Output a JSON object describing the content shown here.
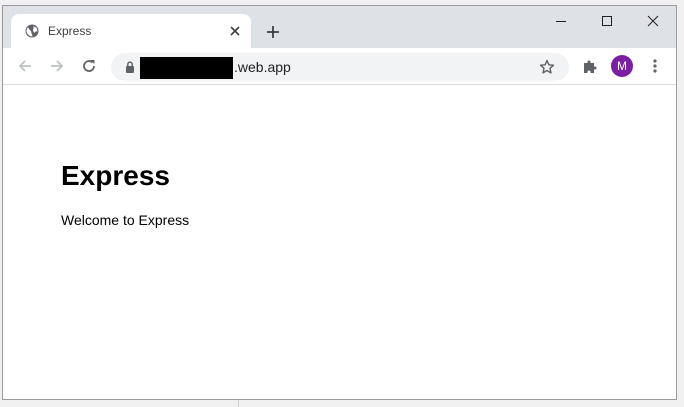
{
  "browser": {
    "tab": {
      "title": "Express",
      "favicon": "globe-icon"
    },
    "address": {
      "url_visible": ".web.app",
      "redacted": true
    },
    "profile_initial": "M",
    "profile_color": "#7b1fa2"
  },
  "page": {
    "heading": "Express",
    "body": "Welcome to Express"
  }
}
